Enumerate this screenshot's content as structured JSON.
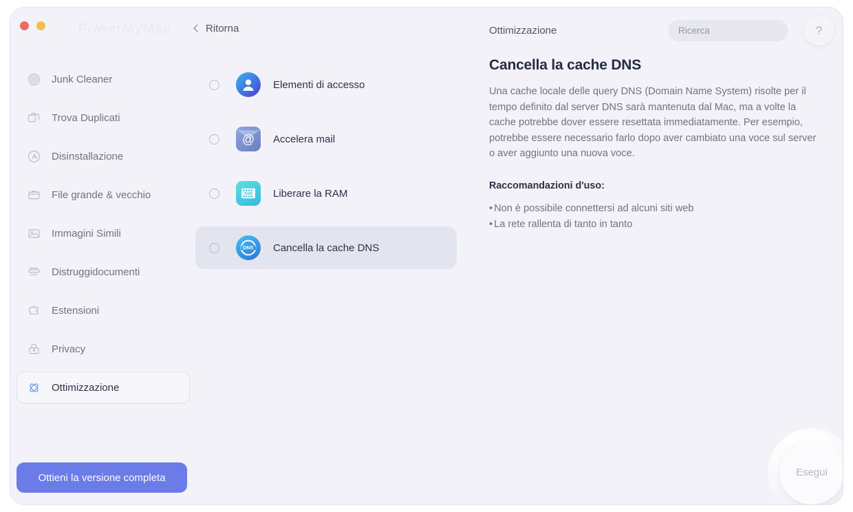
{
  "window": {
    "watermark": "PowerMyMac",
    "back_label": "Ritorna",
    "traffic_lights": [
      "close-red",
      "minimize-yellow"
    ],
    "bg_color": "#f3f2f8"
  },
  "sidebar": {
    "items": [
      {
        "label": "Junk Cleaner",
        "icon": "target-rings-icon",
        "active": false
      },
      {
        "label": "Trova Duplicati",
        "icon": "duplicate-files-icon",
        "active": false
      },
      {
        "label": "Disinstallazione",
        "icon": "app-uninstall-icon",
        "active": false
      },
      {
        "label": "File grande & vecchio",
        "icon": "archive-box-icon",
        "active": false
      },
      {
        "label": "Immagini Simili",
        "icon": "photo-icon",
        "active": false
      },
      {
        "label": "Distruggidocumenti",
        "icon": "shredder-icon",
        "active": false
      },
      {
        "label": "Estensioni",
        "icon": "puzzle-piece-icon",
        "active": false
      },
      {
        "label": "Privacy",
        "icon": "lock-icon",
        "active": false
      },
      {
        "label": "Ottimizzazione",
        "icon": "atom-optimize-icon",
        "active": true
      }
    ],
    "cta_label": "Ottieni la versione completa",
    "cta_color": "#6b7ce8"
  },
  "optimizations": [
    {
      "label": "Elementi di accesso",
      "icon": "user-circle-icon",
      "selected": false,
      "checked": false
    },
    {
      "label": "Accelera mail",
      "icon": "mail-at-icon",
      "selected": false,
      "checked": false
    },
    {
      "label": "Liberare la RAM",
      "icon": "ram-chip-icon",
      "selected": false,
      "checked": false
    },
    {
      "label": "Cancella la cache DNS",
      "icon": "dns-globe-icon",
      "selected": true,
      "checked": false
    }
  ],
  "header": {
    "panel_title": "Ottimizzazione",
    "search_placeholder": "Ricerca",
    "search_value": "",
    "help_label": "?"
  },
  "detail": {
    "title": "Cancella la cache DNS",
    "body": "Una cache locale delle query DNS (Domain Name System) risolte per il tempo definito dal server DNS sarà mantenuta dal Mac, ma a volte la cache potrebbe dover essere resettata immediatamente. Per esempio, potrebbe essere necessario farlo dopo aver cambiato una voce sul server o aver aggiunto una nuova voce.",
    "recommendations_title": "Raccomandazioni d'uso:",
    "recommendations": [
      "Non è possibile connettersi ad alcuni siti web",
      "La rete rallenta di tanto in tanto"
    ]
  },
  "run_button": {
    "label": "Esegui"
  }
}
